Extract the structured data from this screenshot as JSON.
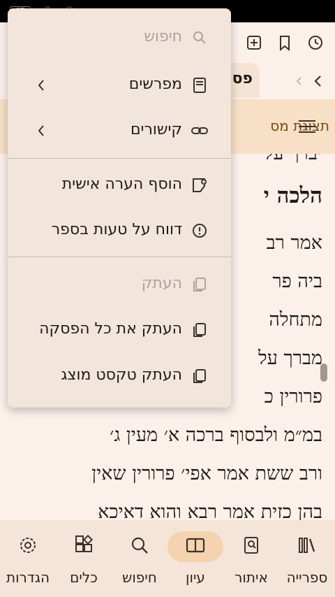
{
  "status_bar": {
    "battery": "67"
  },
  "toolbar": {
    "icons": [
      "history-icon",
      "bookmark-icon",
      "add-tab-icon"
    ]
  },
  "tabs": {
    "active_label": "פס"
  },
  "banner": {
    "text": "תצוגת מס"
  },
  "content": {
    "lines": [
      {
        "text": "יברך על",
        "heading": false
      },
      {
        "text": "הלכה י",
        "heading": true
      },
      {
        "text": "אמר רב",
        "heading": false
      },
      {
        "text": "ביה פר",
        "heading": false
      },
      {
        "text": "מתחלה",
        "heading": false
      },
      {
        "text": "מברך על",
        "heading": false
      },
      {
        "text": "פרורין כ",
        "heading": false
      },
      {
        "text": "במ״מ ולבסוף ברכה א׳ מעין ג׳",
        "heading": false
      },
      {
        "text": "ורב ששת אמר אפי׳ פרורין שאין",
        "heading": false
      },
      {
        "text": "בהן כזית אמר רבא והוא דאיכא",
        "heading": false
      }
    ]
  },
  "menu": {
    "search_placeholder": "חיפוש",
    "commentaries": "מפרשים",
    "links": "קישורים",
    "add_note": "הוסף הערה אישית",
    "report_error": "דווח על טעות בספר",
    "copy": "העתק",
    "copy_paragraph": "העתק את כל הפסקה",
    "copy_displayed": "העתק טקסט מוצג"
  },
  "bottom_nav": {
    "library": "ספרייה",
    "locate": "איתור",
    "study": "עיון",
    "search": "חיפוש",
    "tools": "כלים",
    "settings": "הגדרות"
  },
  "colors": {
    "accent": "#f4d3ae",
    "banner": "#f7e0c6",
    "banner_text": "#7a4a10",
    "menu_bg": "#f1e5dc"
  }
}
